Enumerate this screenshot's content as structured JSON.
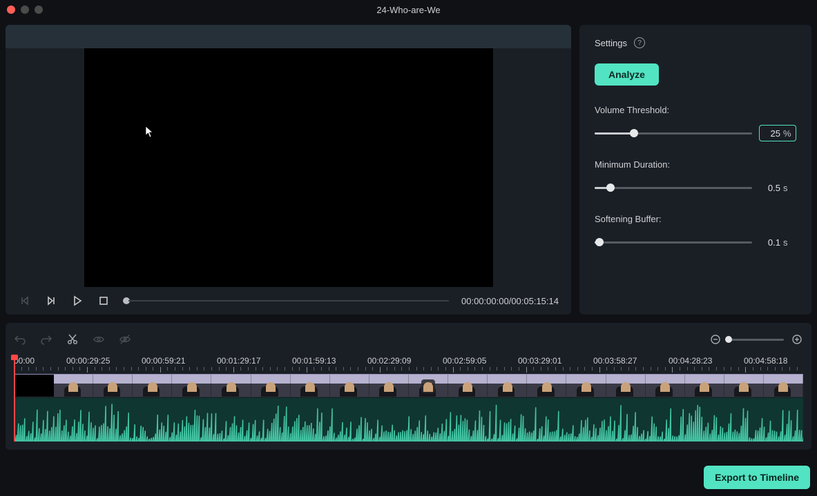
{
  "window": {
    "title": "24-Who-are-We"
  },
  "transport": {
    "current_time": "00:00:00:00",
    "total_time": "00:05:15:14"
  },
  "settings": {
    "heading": "Settings",
    "analyze_label": "Analyze",
    "volume_threshold": {
      "label": "Volume Threshold:",
      "value": "25",
      "unit": "%",
      "percent": 25
    },
    "minimum_duration": {
      "label": "Minimum Duration:",
      "value": "0.5",
      "unit": "s",
      "percent": 10
    },
    "softening_buffer": {
      "label": "Softening Buffer:",
      "value": "0.1",
      "unit": "s",
      "percent": 3
    }
  },
  "timeline": {
    "timecodes": [
      "00:00",
      "00:00:29:25",
      "00:00:59:21",
      "00:01:29:17",
      "00:01:59:13",
      "00:02:29:09",
      "00:02:59:05",
      "00:03:29:01",
      "00:03:58:27",
      "00:04:28:23",
      "00:04:58:18"
    ]
  },
  "footer": {
    "export_label": "Export to Timeline"
  }
}
